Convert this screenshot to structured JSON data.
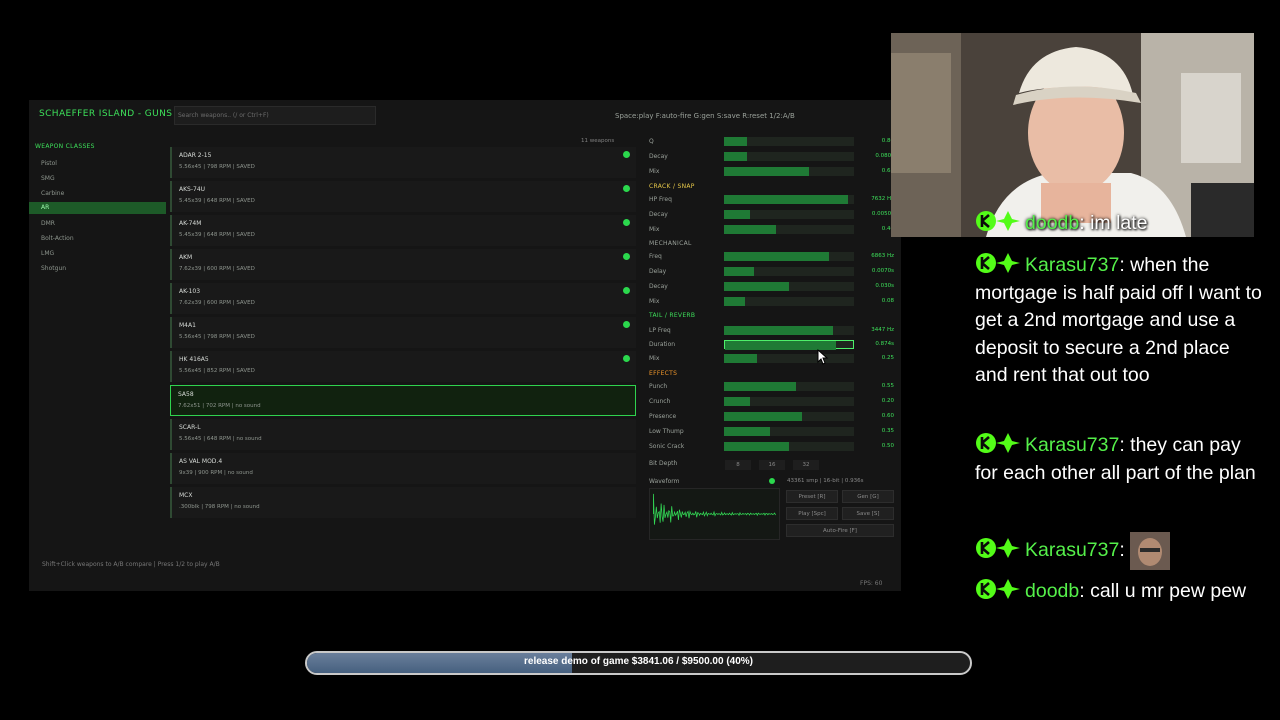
{
  "app": {
    "title": "SCHAEFFER ISLAND - GUNS",
    "search_placeholder": "Search weapons.. (/ or Ctrl+F)",
    "hotkeys": "Space:play  F:auto-fire  G:gen  S:save  R:reset  1/2:A/B",
    "fps": "FPS: 60",
    "footer_hint": "Shift+Click weapons to A/B compare  |  Press 1/2 to play A/B"
  },
  "sidebar": {
    "title": "WEAPON CLASSES",
    "items": [
      {
        "label": "Pistol",
        "active": false
      },
      {
        "label": "SMG",
        "active": false
      },
      {
        "label": "Carbine",
        "active": false
      },
      {
        "label": "AR",
        "active": true
      },
      {
        "label": "DMR",
        "active": false
      },
      {
        "label": "Bolt-Action",
        "active": false
      },
      {
        "label": "LMG",
        "active": false
      },
      {
        "label": "Shotgun",
        "active": false
      }
    ]
  },
  "weapons": {
    "count": "11 weapons",
    "rows": [
      {
        "name": "ADAR 2-15",
        "info": "5.56x45  |  798 RPM  |  SAVED",
        "saved": true,
        "selected": false
      },
      {
        "name": "AKS-74U",
        "info": "5.45x39  |  648 RPM  |  SAVED",
        "saved": true,
        "selected": false
      },
      {
        "name": "AK-74M",
        "info": "5.45x39  |  648 RPM  |  SAVED",
        "saved": true,
        "selected": false
      },
      {
        "name": "AKM",
        "info": "7.62x39  |  600 RPM  |  SAVED",
        "saved": true,
        "selected": false
      },
      {
        "name": "AK-103",
        "info": "7.62x39  |  600 RPM  |  SAVED",
        "saved": true,
        "selected": false
      },
      {
        "name": "M4A1",
        "info": "5.56x45  |  798 RPM  |  SAVED",
        "saved": true,
        "selected": false
      },
      {
        "name": "HK 416A5",
        "info": "5.56x45  |  852 RPM  |  SAVED",
        "saved": true,
        "selected": false
      },
      {
        "name": "SA58",
        "info": "7.62x51  |  702 RPM  |  no sound",
        "saved": false,
        "selected": true
      },
      {
        "name": "SCAR-L",
        "info": "5.56x45  |  648 RPM  |  no sound",
        "saved": false,
        "selected": false
      },
      {
        "name": "AS VAL MOD.4",
        "info": "9x39  |  900 RPM  |  no sound",
        "saved": false,
        "selected": false
      },
      {
        "name": "MCX",
        "info": ".300blk  |  798 RPM  |  no sound",
        "saved": false,
        "selected": false
      }
    ]
  },
  "params": {
    "sections": [
      {
        "title": "",
        "color": "",
        "items": [
          {
            "label": "Q",
            "fill": 0.18,
            "value": "0.80"
          },
          {
            "label": "Decay",
            "fill": 0.18,
            "value": "0.080s"
          },
          {
            "label": "Mix",
            "fill": 0.65,
            "value": "0.65"
          }
        ]
      },
      {
        "title": "CRACK / SNAP",
        "color": "#e6c84a",
        "items": [
          {
            "label": "HP Freq",
            "fill": 0.95,
            "value": "7632 Hz"
          },
          {
            "label": "Decay",
            "fill": 0.2,
            "value": "0.0050s"
          },
          {
            "label": "Mix",
            "fill": 0.4,
            "value": "0.40"
          }
        ]
      },
      {
        "title": "MECHANICAL",
        "color": "#9aa19a",
        "items": [
          {
            "label": "Freq",
            "fill": 0.81,
            "value": "6863 Hz"
          },
          {
            "label": "Delay",
            "fill": 0.23,
            "value": "0.0070s"
          },
          {
            "label": "Decay",
            "fill": 0.5,
            "value": "0.030s"
          },
          {
            "label": "Mix",
            "fill": 0.16,
            "value": "0.08"
          }
        ]
      },
      {
        "title": "TAIL / REVERB",
        "color": "#3de05a",
        "items": [
          {
            "label": "LP Freq",
            "fill": 0.84,
            "value": "3447 Hz"
          },
          {
            "label": "Duration",
            "fill": 0.87,
            "value": "0.874s",
            "hot": true
          },
          {
            "label": "Mix",
            "fill": 0.25,
            "value": "0.25"
          }
        ]
      },
      {
        "title": "EFFECTS",
        "color": "#f0962a",
        "items": [
          {
            "label": "Punch",
            "fill": 0.55,
            "value": "0.55"
          },
          {
            "label": "Crunch",
            "fill": 0.2,
            "value": "0.20"
          },
          {
            "label": "Presence",
            "fill": 0.6,
            "value": "0.60"
          },
          {
            "label": "Low Thump",
            "fill": 0.35,
            "value": "0.35"
          },
          {
            "label": "Sonic Crack",
            "fill": 0.5,
            "value": "0.50"
          }
        ]
      }
    ],
    "bit_depth": {
      "label": "Bit Depth",
      "options": [
        "8",
        "16",
        "32"
      ]
    }
  },
  "waveform": {
    "label": "Waveform",
    "stats": "43361 smp  |  16-bit  |  0.936s",
    "buttons": {
      "preset": "Preset [R]",
      "gen": "Gen [G]",
      "play": "Play [Spc]",
      "save": "Save [S]",
      "autofire": "Auto-Fire [F]"
    }
  },
  "chat": [
    {
      "user": "doodb",
      "message": "im late"
    },
    {
      "user": "Karasu737",
      "message": "when the mortgage is half paid off I want to get a 2nd mortgage and use a deposit to secure a 2nd place and rent that out too"
    },
    {
      "user": "Karasu737",
      "message": "they can pay for each other all part of the plan"
    },
    {
      "user": "Karasu737",
      "message": "",
      "emote": true
    },
    {
      "user": "doodb",
      "message": "call u mr pew pew"
    }
  ],
  "goal": {
    "text": "release demo of game $3841.06 / $9500.00 (40%)",
    "progress": 0.4
  },
  "colors": {
    "accent": "#3de05a",
    "chat_user": "#55f04a",
    "goal_fill": "#5a7394"
  }
}
